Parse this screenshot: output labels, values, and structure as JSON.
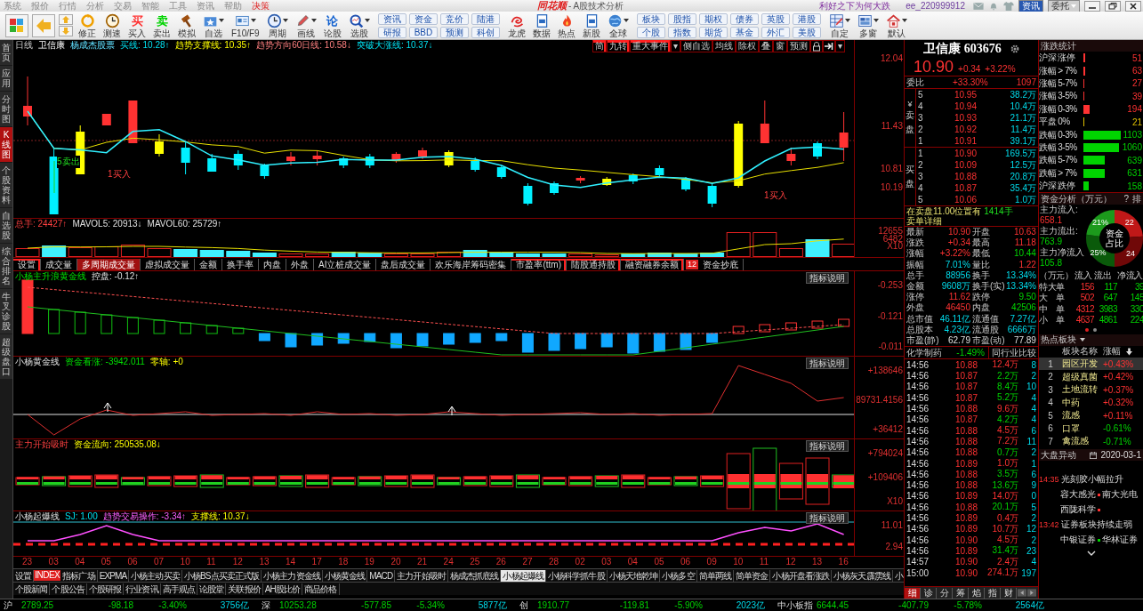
{
  "menu": [
    {
      "label": "系统",
      "kind": "plain"
    },
    {
      "label": "报价",
      "kind": "plain"
    },
    {
      "label": "行情",
      "kind": "plain"
    },
    {
      "label": "分析",
      "kind": "plain"
    },
    {
      "label": "交易",
      "kind": "plain"
    },
    {
      "label": "智能",
      "kind": "plain"
    },
    {
      "label": "工具",
      "kind": "plain"
    },
    {
      "label": "资讯",
      "kind": "plain"
    },
    {
      "label": "帮助",
      "kind": "plain"
    },
    {
      "label": "决策",
      "kind": "highlight"
    }
  ],
  "title": {
    "logo": "同花顺",
    "text": "- A股技术分析"
  },
  "headline": "利好之下为何大跌",
  "user": "ee_220999912",
  "top_buttons": [
    {
      "label": "资讯",
      "kind": "primary"
    },
    {
      "label": "委托",
      "kind": "dropdown"
    }
  ],
  "toolbar": {
    "tools": [
      {
        "label": "修正",
        "dropdown": false
      },
      {
        "label": "测速",
        "dropdown": false
      },
      {
        "label": "买入",
        "glyph": "买",
        "kind": "up",
        "dropdown": false
      },
      {
        "label": "卖出",
        "glyph": "卖",
        "kind": "down",
        "dropdown": false
      },
      {
        "label": "模拟",
        "dropdown": false
      },
      {
        "label": "自选",
        "dropdown": true
      },
      {
        "label": "F10/F9",
        "dropdown": true
      },
      {
        "label": "周期",
        "dropdown": true
      },
      {
        "label": "画线",
        "dropdown": true
      },
      {
        "label": "论股",
        "glyph": "论",
        "kind": "blue",
        "dropdown": false
      },
      {
        "label": "选股",
        "dropdown": true
      }
    ],
    "quick": [
      [
        "资讯",
        "研报"
      ],
      [
        "资金",
        "BBD"
      ],
      [
        "竞价",
        "预测"
      ],
      [
        "陆港",
        "科创"
      ]
    ],
    "apps": [
      {
        "label": "龙虎",
        "dropdown": false
      },
      {
        "label": "数据",
        "dropdown": false
      },
      {
        "label": "热点",
        "dropdown": false
      },
      {
        "label": "新股",
        "dropdown": false
      },
      {
        "label": "全球",
        "dropdown": true
      }
    ],
    "markets": [
      [
        "板块",
        "个股"
      ],
      [
        "股指",
        "指数"
      ],
      [
        "期权",
        "期货"
      ],
      [
        "债券",
        "基金"
      ],
      [
        "英股",
        "外汇"
      ],
      [
        "港股",
        "美股"
      ]
    ],
    "layouts": [
      {
        "label": "自定",
        "dropdown": true
      },
      {
        "label": "多窗",
        "dropdown": true
      },
      {
        "label": "默认",
        "dropdown": true
      }
    ]
  },
  "side_tabs": [
    {
      "label": "首页",
      "selected": false
    },
    {
      "label": "应用",
      "selected": false
    },
    {
      "label": "分时图",
      "selected": false
    },
    {
      "label": "K线图",
      "selected": true
    },
    {
      "label": "个股资料",
      "selected": false
    },
    {
      "label": "自选股",
      "selected": false
    },
    {
      "label": "综合排名",
      "selected": false
    },
    {
      "label": "牛叉诊股",
      "selected": false
    },
    {
      "label": "超级盘口",
      "selected": false
    }
  ],
  "chart_header": {
    "period": "日线",
    "stock": "卫信康",
    "formula": "杨成杰股票",
    "lines": [
      {
        "label": "买线:",
        "value": "10.28↑"
      },
      {
        "label": "趋势支撑线:",
        "value": "10.35↑"
      },
      {
        "label": "趋势方向60日线:",
        "value": "10.58↓"
      },
      {
        "label": "突破大涨线:",
        "value": "10.37↓"
      }
    ]
  },
  "chart_tools": [
    {
      "kind": "text",
      "label": "简",
      "dot": true
    },
    {
      "kind": "text",
      "label": "九转",
      "dot": true
    },
    {
      "kind": "text",
      "label": "重大事件",
      "dot": true
    },
    {
      "kind": "text",
      "label": "▾",
      "dot": false
    },
    {
      "kind": "text",
      "label": "侧自选",
      "dot": false
    },
    {
      "kind": "text",
      "label": "均线",
      "dot": false
    },
    {
      "kind": "text",
      "label": "除权",
      "dot": false
    },
    {
      "kind": "text",
      "label": "叠",
      "dot": false
    },
    {
      "kind": "text",
      "label": "窗",
      "dot": false
    },
    {
      "kind": "text",
      "label": "预测",
      "dot": false
    },
    {
      "kind": "icon"
    },
    {
      "kind": "icon"
    },
    {
      "kind": "text",
      "label": "▾",
      "dot": false
    }
  ],
  "price_axis": [
    "12.04",
    "11.43",
    "10.81",
    "10.19"
  ],
  "signals": [
    {
      "label": "5卖出",
      "kind": "sell"
    },
    {
      "label": "1买入",
      "kind": "buy"
    },
    {
      "label": "1买入",
      "kind": "buy"
    }
  ],
  "volume": {
    "legend": [
      "总手: 24427↑",
      "MAVOL5: 20913↓",
      "MAVOL60: 25729↑"
    ],
    "axis": [
      "12655",
      "6482",
      "X10"
    ]
  },
  "indicator_tabs": [
    {
      "label": "设置",
      "selected": false,
      "dot": true
    },
    {
      "label": "成交量",
      "selected": false,
      "dot": false
    },
    {
      "label": "多周期成交量",
      "selected": true,
      "dot": false
    },
    {
      "label": "虚拟成交量",
      "selected": false,
      "dot": false
    },
    {
      "label": "金额",
      "selected": false,
      "dot": false
    },
    {
      "label": "换手率",
      "selected": false,
      "dot": false
    },
    {
      "label": "内盘",
      "selected": false,
      "dot": false
    },
    {
      "label": "外盘",
      "selected": false,
      "dot": false
    },
    {
      "label": "AI立桩成交量",
      "selected": false,
      "dot": false
    },
    {
      "label": "盘后成交量",
      "selected": false,
      "dot": false
    },
    {
      "label": "欢乐海岸筹码密集",
      "selected": false,
      "dot": false
    },
    {
      "label": "市盈率(ttm)",
      "selected": false,
      "dot": true
    },
    {
      "label": "陆股通持股",
      "selected": false,
      "dot": true
    },
    {
      "label": "融资融券余额",
      "selected": false,
      "dot": true
    },
    {
      "label": "资金抄底",
      "selected": false,
      "dot": false,
      "badge": "12"
    }
  ],
  "panes": [
    {
      "kind": "wave",
      "legend": [
        "小杨主升浪黄金线",
        "控盘: -0.12↑"
      ],
      "button": "指标说明",
      "axis": [
        "-0.253",
        "-0.121",
        "-0.011"
      ]
    },
    {
      "kind": "flow",
      "legend": [
        "小杨黄金线",
        "资金看涨: -3942.011",
        "零轴: +0"
      ],
      "button": "指标说明",
      "axis": [
        "+138646",
        "89731.4156",
        "+36412"
      ]
    },
    {
      "kind": "boxes",
      "legend": [
        "主力开始吸时",
        "资金流向: 250535.08↓"
      ],
      "button": "指标说明",
      "axis": [
        "+794024",
        "+109406",
        "X10"
      ]
    },
    {
      "kind": "burst",
      "legend": [
        "小杨起爆线",
        "SJ: 1.00",
        "趋势交易操作: -3.34↑",
        "支撑线: 10.37↓"
      ],
      "button": "指标说明",
      "axis": [
        "11.01",
        "2.94"
      ]
    }
  ],
  "dates": [
    "23",
    "03",
    "04",
    "05",
    "06",
    "07",
    "10",
    "11",
    "12",
    "13",
    "14",
    "17",
    "18",
    "19",
    "20",
    "21",
    "24",
    "25",
    "26",
    "27",
    "28",
    "02",
    "03",
    "04",
    "05",
    "06",
    "09",
    "10",
    "11",
    "12",
    "13",
    "16"
  ],
  "bottom_tabs": [
    {
      "label": "设置",
      "selected": false
    },
    {
      "label": "指标广场",
      "selected": false,
      "badge": "INDEX"
    },
    {
      "label": "EXPMA",
      "selected": false
    },
    {
      "label": "小杨主动买卖",
      "selected": false
    },
    {
      "label": "小杨BS点买卖正式版",
      "selected": false
    },
    {
      "label": "小杨主力资金线",
      "selected": false
    },
    {
      "label": "小杨黄金线",
      "selected": false
    },
    {
      "label": "MACD",
      "selected": false
    },
    {
      "label": "主力开始吸时",
      "selected": false
    },
    {
      "label": "杨成杰抓底线",
      "selected": false
    },
    {
      "label": "小杨起爆线",
      "selected": true
    },
    {
      "label": "小杨科学抓牛股",
      "selected": false
    },
    {
      "label": "小杨天地乾坤",
      "selected": false
    },
    {
      "label": "小杨多空",
      "selected": false
    },
    {
      "label": "简单两线",
      "selected": false
    },
    {
      "label": "简单资金",
      "selected": false
    },
    {
      "label": "小杨开盘看涨跌",
      "selected": false
    },
    {
      "label": "小杨灰天霹雳线",
      "selected": false
    },
    {
      "label": "小",
      "selected": false
    }
  ],
  "info_tabs": [
    "个股新闻",
    "个股公告",
    "个股研报",
    "行业资讯",
    "高手观点",
    "论股堂",
    "关联报价",
    "AH股比价",
    "商品价格"
  ],
  "quote": {
    "name": "卫信康 603676",
    "price": "10.90",
    "change": "+0.34",
    "pct": "+3.22%",
    "ratio_label": "委比",
    "ratio": "+33.30%",
    "ratio_diff": "1097",
    "currency": "¥",
    "ask_label": "卖盘",
    "bid_label": "买盘",
    "asks": [
      {
        "level": "5",
        "price": "10.95",
        "volume": "38.2万"
      },
      {
        "level": "4",
        "price": "10.94",
        "volume": "10.4万"
      },
      {
        "level": "3",
        "price": "10.93",
        "volume": "21.1万"
      },
      {
        "level": "2",
        "price": "10.92",
        "volume": "11.4万"
      },
      {
        "level": "1",
        "price": "10.91",
        "volume": "39.1万"
      }
    ],
    "bids": [
      {
        "level": "1",
        "price": "10.90",
        "volume": "169.5万"
      },
      {
        "level": "2",
        "price": "10.09",
        "volume": "12.5万"
      },
      {
        "level": "3",
        "price": "10.88",
        "volume": "20.8万"
      },
      {
        "level": "4",
        "price": "10.87",
        "volume": "35.4万"
      },
      {
        "level": "5",
        "price": "10.06",
        "volume": "1.0万"
      }
    ],
    "notice": {
      "text": "在卖盘11.00位置有",
      "amount": "1414手",
      "link": "卖单详细"
    },
    "stats": [
      {
        "label": "最新",
        "value": "10.90",
        "kind": "up"
      },
      {
        "label": "开盘",
        "value": "10.63",
        "kind": "up"
      },
      {
        "label": "涨跌",
        "value": "+0.34",
        "kind": "up"
      },
      {
        "label": "最高",
        "value": "11.18",
        "kind": "up"
      },
      {
        "label": "涨幅",
        "value": "+3.22%",
        "kind": "up"
      },
      {
        "label": "最低",
        "value": "10.44",
        "kind": "down"
      },
      {
        "label": "振幅",
        "value": "7.01%",
        "kind": "neutral"
      },
      {
        "label": "量比",
        "value": "1.22",
        "kind": "up"
      },
      {
        "label": "总手",
        "value": "88956",
        "kind": "neutral"
      },
      {
        "label": "换手",
        "value": "13.34%",
        "kind": "neutral"
      },
      {
        "label": "金额",
        "value": "9608万",
        "kind": "neutral"
      },
      {
        "label": "换手(实)",
        "value": "13.34%",
        "kind": "neutral"
      },
      {
        "label": "涨停",
        "value": "11.62",
        "kind": "up"
      },
      {
        "label": "跌停",
        "value": "9.50",
        "kind": "down"
      },
      {
        "label": "外盘",
        "value": "46450",
        "kind": "up"
      },
      {
        "label": "内盘",
        "value": "42506",
        "kind": "down"
      },
      {
        "label": "总市值",
        "value": "46.11亿",
        "kind": "neutral"
      },
      {
        "label": "流通值",
        "value": "7.27亿",
        "kind": "neutral"
      },
      {
        "label": "总股本",
        "value": "4.23亿",
        "kind": "neutral"
      },
      {
        "label": "流通股",
        "value": "6666万",
        "kind": "neutral"
      },
      {
        "label": "市盈(静)",
        "value": "62.79",
        "kind": "plain"
      },
      {
        "label": "市盈(动)",
        "value": "77.89",
        "kind": "plain"
      }
    ],
    "industry": {
      "name": "化学制药",
      "pct": "-1.49%",
      "button": "同行业比较"
    }
  },
  "ticks": [
    {
      "time": "14:56",
      "price": "10.88",
      "volume": "12.4万",
      "kind": "buy",
      "count": "8"
    },
    {
      "time": "14:56",
      "price": "10.87",
      "volume": "2.2万",
      "kind": "sell",
      "count": "2"
    },
    {
      "time": "14:56",
      "price": "10.87",
      "volume": "8.4万",
      "kind": "sell",
      "count": "10"
    },
    {
      "time": "14:56",
      "price": "10.87",
      "volume": "5.2万",
      "kind": "sell",
      "count": "4"
    },
    {
      "time": "14:56",
      "price": "10.88",
      "volume": "9.6万",
      "kind": "buy",
      "count": "4"
    },
    {
      "time": "14:56",
      "price": "10.87",
      "volume": "4.2万",
      "kind": "sell",
      "count": "4"
    },
    {
      "time": "14:56",
      "price": "10.88",
      "volume": "4.5万",
      "kind": "buy",
      "count": "6"
    },
    {
      "time": "14:56",
      "price": "10.88",
      "volume": "7.2万",
      "kind": "buy",
      "count": "11"
    },
    {
      "time": "14:56",
      "price": "10.88",
      "volume": "0.7万",
      "kind": "sell",
      "count": "2"
    },
    {
      "time": "14:56",
      "price": "10.89",
      "volume": "1.0万",
      "kind": "buy",
      "count": "1"
    },
    {
      "time": "14:56",
      "price": "10.88",
      "volume": "3.5万",
      "kind": "sell",
      "count": "6"
    },
    {
      "time": "14:56",
      "price": "10.88",
      "volume": "13.6万",
      "kind": "sell",
      "count": "9"
    },
    {
      "time": "14:56",
      "price": "10.89",
      "volume": "14.0万",
      "kind": "buy",
      "count": "0"
    },
    {
      "time": "14:56",
      "price": "10.88",
      "volume": "20.1万",
      "kind": "sell",
      "count": "5"
    },
    {
      "time": "14:56",
      "price": "10.89",
      "volume": "0.4万",
      "kind": "buy",
      "count": "2"
    },
    {
      "time": "14:56",
      "price": "10.89",
      "volume": "10.7万",
      "kind": "buy",
      "count": "12"
    },
    {
      "time": "14:56",
      "price": "10.90",
      "volume": "4.5万",
      "kind": "buy",
      "count": "2"
    },
    {
      "time": "14:56",
      "price": "10.89",
      "volume": "31.4万",
      "kind": "sell",
      "count": "23"
    },
    {
      "time": "14:57",
      "price": "10.90",
      "volume": "2.4万",
      "kind": "buy",
      "count": "4"
    },
    {
      "time": "15:00",
      "price": "10.90",
      "volume": "274.1万",
      "kind": "buy",
      "count": "197"
    }
  ],
  "tick_tabs": [
    {
      "label": "细",
      "selected": true
    },
    {
      "label": "诊",
      "selected": false
    },
    {
      "label": "分",
      "selected": false
    },
    {
      "label": "筹",
      "selected": false
    },
    {
      "label": "焰",
      "selected": false
    },
    {
      "label": "指",
      "selected": false
    },
    {
      "label": "财",
      "selected": false
    }
  ],
  "breadth": {
    "title": "涨跌统计",
    "rows": [
      {
        "label": "沪深 涨停",
        "count": "51",
        "kind": "up"
      },
      {
        "label": "涨幅 > 7%",
        "count": "63",
        "kind": "up"
      },
      {
        "label": "涨幅 5-7%",
        "count": "27",
        "kind": "up"
      },
      {
        "label": "涨幅 3-5%",
        "count": "39",
        "kind": "up"
      },
      {
        "label": "涨幅 0-3%",
        "count": "194",
        "kind": "up"
      },
      {
        "label": "平盘  0%",
        "count": "21",
        "kind": "flat"
      },
      {
        "label": "跌幅 0-3%",
        "count": "1103",
        "kind": "down"
      },
      {
        "label": "跌幅 3-5%",
        "count": "1060",
        "kind": "down"
      },
      {
        "label": "跌幅 5-7%",
        "count": "639",
        "kind": "down"
      },
      {
        "label": "跌幅 > 7%",
        "count": "631",
        "kind": "down"
      },
      {
        "label": "沪深 跌停",
        "count": "158",
        "kind": "down"
      }
    ]
  },
  "funds": {
    "title": "资金分析（万元）",
    "help": "?",
    "rank": "排",
    "inflow_label": "主力流入:",
    "inflow": "658.1",
    "outflow_label": "主力流出:",
    "outflow": "763.9",
    "net_label": "主力净流入",
    "net": "105.8",
    "center": "资金占比",
    "chart_data": {
      "type": "donut",
      "values": [
        22,
        24,
        25,
        21
      ],
      "colors": [
        "#c01818",
        "#700808",
        "#0a5a0a",
        "#1c9a1c"
      ],
      "value_labels": [
        "22",
        "24",
        "25%",
        "21%"
      ]
    },
    "table_head": [
      "（万元）",
      "流入",
      "流出",
      "净流入"
    ],
    "rows": [
      {
        "label": "特大单",
        "inflow": "156",
        "outflow": "117",
        "net": "39"
      },
      {
        "label": "大　单",
        "inflow": "502",
        "outflow": "647",
        "net": "145"
      },
      {
        "label": "中　单",
        "inflow": "4312",
        "outflow": "3983",
        "net": "330"
      },
      {
        "label": "小　单",
        "inflow": "4637",
        "outflow": "4861",
        "net": "224"
      }
    ],
    "pages": [
      {
        "selected": true
      },
      {
        "selected": false
      }
    ]
  },
  "hot": {
    "title": "热点板块",
    "head": [
      "板块名称",
      "涨幅"
    ],
    "rows": [
      {
        "rank": "1",
        "name": "园区开发",
        "pct": "+0.43%",
        "kind": "up",
        "selected": true
      },
      {
        "rank": "2",
        "name": "超级真菌",
        "pct": "+0.42%",
        "kind": "up",
        "selected": false
      },
      {
        "rank": "3",
        "name": "土地流转",
        "pct": "+0.37%",
        "kind": "up",
        "selected": false
      },
      {
        "rank": "4",
        "name": "中药",
        "pct": "+0.32%",
        "kind": "up",
        "selected": false
      },
      {
        "rank": "5",
        "name": "流感",
        "pct": "+0.11%",
        "kind": "up",
        "selected": false
      },
      {
        "rank": "6",
        "name": "口罩",
        "pct": "-0.61%",
        "kind": "down",
        "selected": false
      },
      {
        "rank": "7",
        "name": "禽流感",
        "pct": "-0.71%",
        "kind": "down",
        "selected": false
      }
    ]
  },
  "moves": {
    "title": "大盘异动",
    "date": "2020-03-1",
    "events": [
      {
        "time": "14:35",
        "title": "光刻胶小幅拉升",
        "stocks": [
          [
            {
              "name": "容大感光",
              "kind": "up"
            },
            {
              "name": "南大光电",
              "kind": "none"
            }
          ],
          [
            {
              "name": "西陇科学",
              "kind": "up"
            }
          ]
        ]
      },
      {
        "time": "13:42",
        "title": "证券板块持续走弱",
        "stocks": [
          [
            {
              "name": "中银证券",
              "kind": "down"
            },
            {
              "name": "华林证券",
              "kind": "none"
            }
          ]
        ]
      }
    ]
  },
  "status": [
    {
      "market": "沪",
      "index": "2789.25",
      "change": "-98.18",
      "pct": "-3.40%",
      "amount": "3756亿"
    },
    {
      "market": "深",
      "index": "10253.28",
      "change": "-577.85",
      "pct": "-5.34%",
      "amount": "5877亿"
    },
    {
      "market": "创",
      "index": "1910.77",
      "change": "-119.81",
      "pct": "-5.90%",
      "amount": "2023亿"
    },
    {
      "market": "中小板指",
      "index": "6644.45",
      "change": "-407.79",
      "pct": "-5.78%",
      "amount": "2564亿"
    }
  ]
}
